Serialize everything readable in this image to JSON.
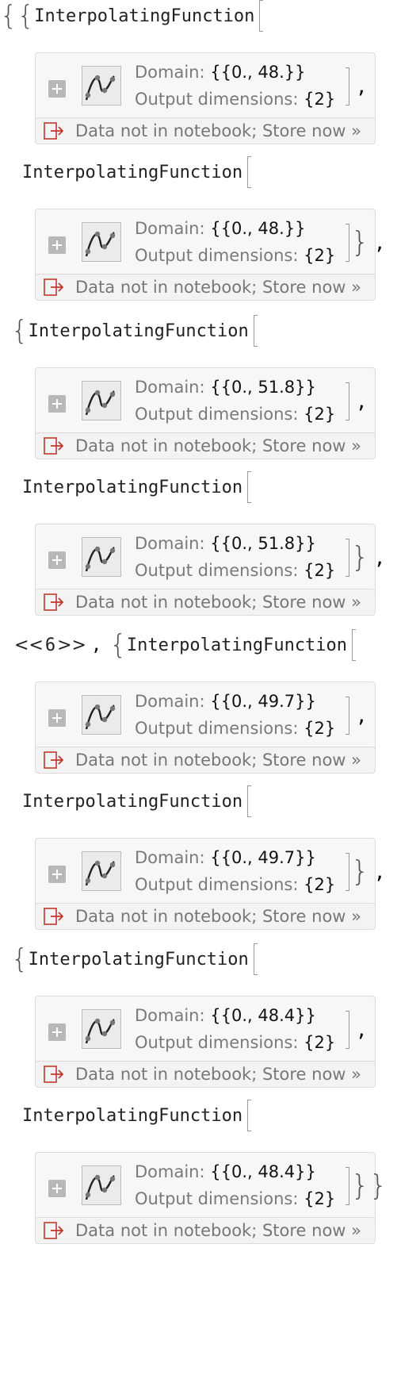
{
  "function_label": "InterpolatingFunction",
  "domain_label": "Domain:",
  "output_dims_label": "Output dimensions:",
  "store_message": "Data not in notebook; Store now »",
  "omitted": {
    "open": "<<",
    "count": "6",
    "close": ">>"
  },
  "items": [
    {
      "domain": "{{0., 48.}}",
      "output_dims": "{2}"
    },
    {
      "domain": "{{0., 48.}}",
      "output_dims": "{2}"
    },
    {
      "domain": "{{0., 51.8}}",
      "output_dims": "{2}"
    },
    {
      "domain": "{{0., 51.8}}",
      "output_dims": "{2}"
    },
    {
      "domain": "{{0., 49.7}}",
      "output_dims": "{2}"
    },
    {
      "domain": "{{0., 49.7}}",
      "output_dims": "{2}"
    },
    {
      "domain": "{{0., 48.4}}",
      "output_dims": "{2}"
    },
    {
      "domain": "{{0., 48.4}}",
      "output_dims": "{2}"
    }
  ],
  "icons": {
    "expand": "plus-icon",
    "thumbnail": "interpolation-curve-icon",
    "store": "store-data-icon"
  }
}
